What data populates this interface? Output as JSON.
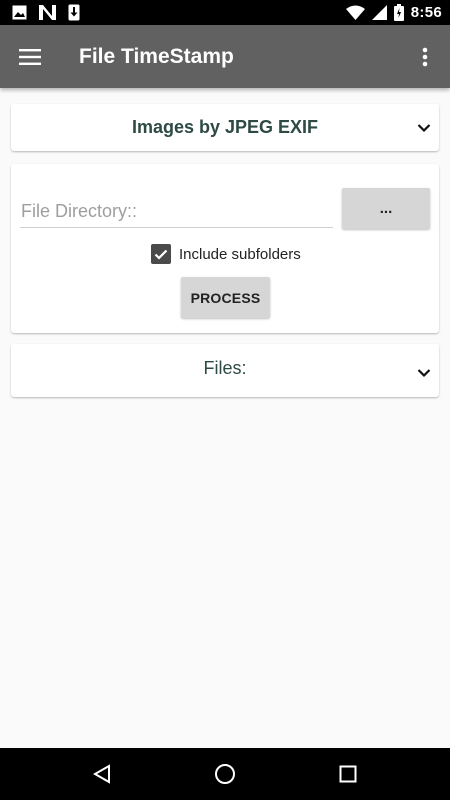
{
  "status_bar": {
    "time": "8:56",
    "left_icons": [
      "image-icon",
      "n-icon",
      "download-icon"
    ],
    "right_icons": [
      "wifi-icon",
      "signal-icon",
      "battery-icon"
    ]
  },
  "app_bar": {
    "title": "File TimeStamp",
    "color": "#616161"
  },
  "mode_card": {
    "selected_mode": "Images by JPEG EXIF"
  },
  "directory_card": {
    "directory_placeholder": "File Directory::",
    "directory_value": "",
    "browse_label": "...",
    "include_subfolders_label": "Include subfolders",
    "include_subfolders_checked": true,
    "process_label": "PROCESS"
  },
  "files_card": {
    "label": "Files:"
  },
  "nav_bar": {
    "buttons": [
      "back-icon",
      "home-icon",
      "recents-icon"
    ]
  }
}
